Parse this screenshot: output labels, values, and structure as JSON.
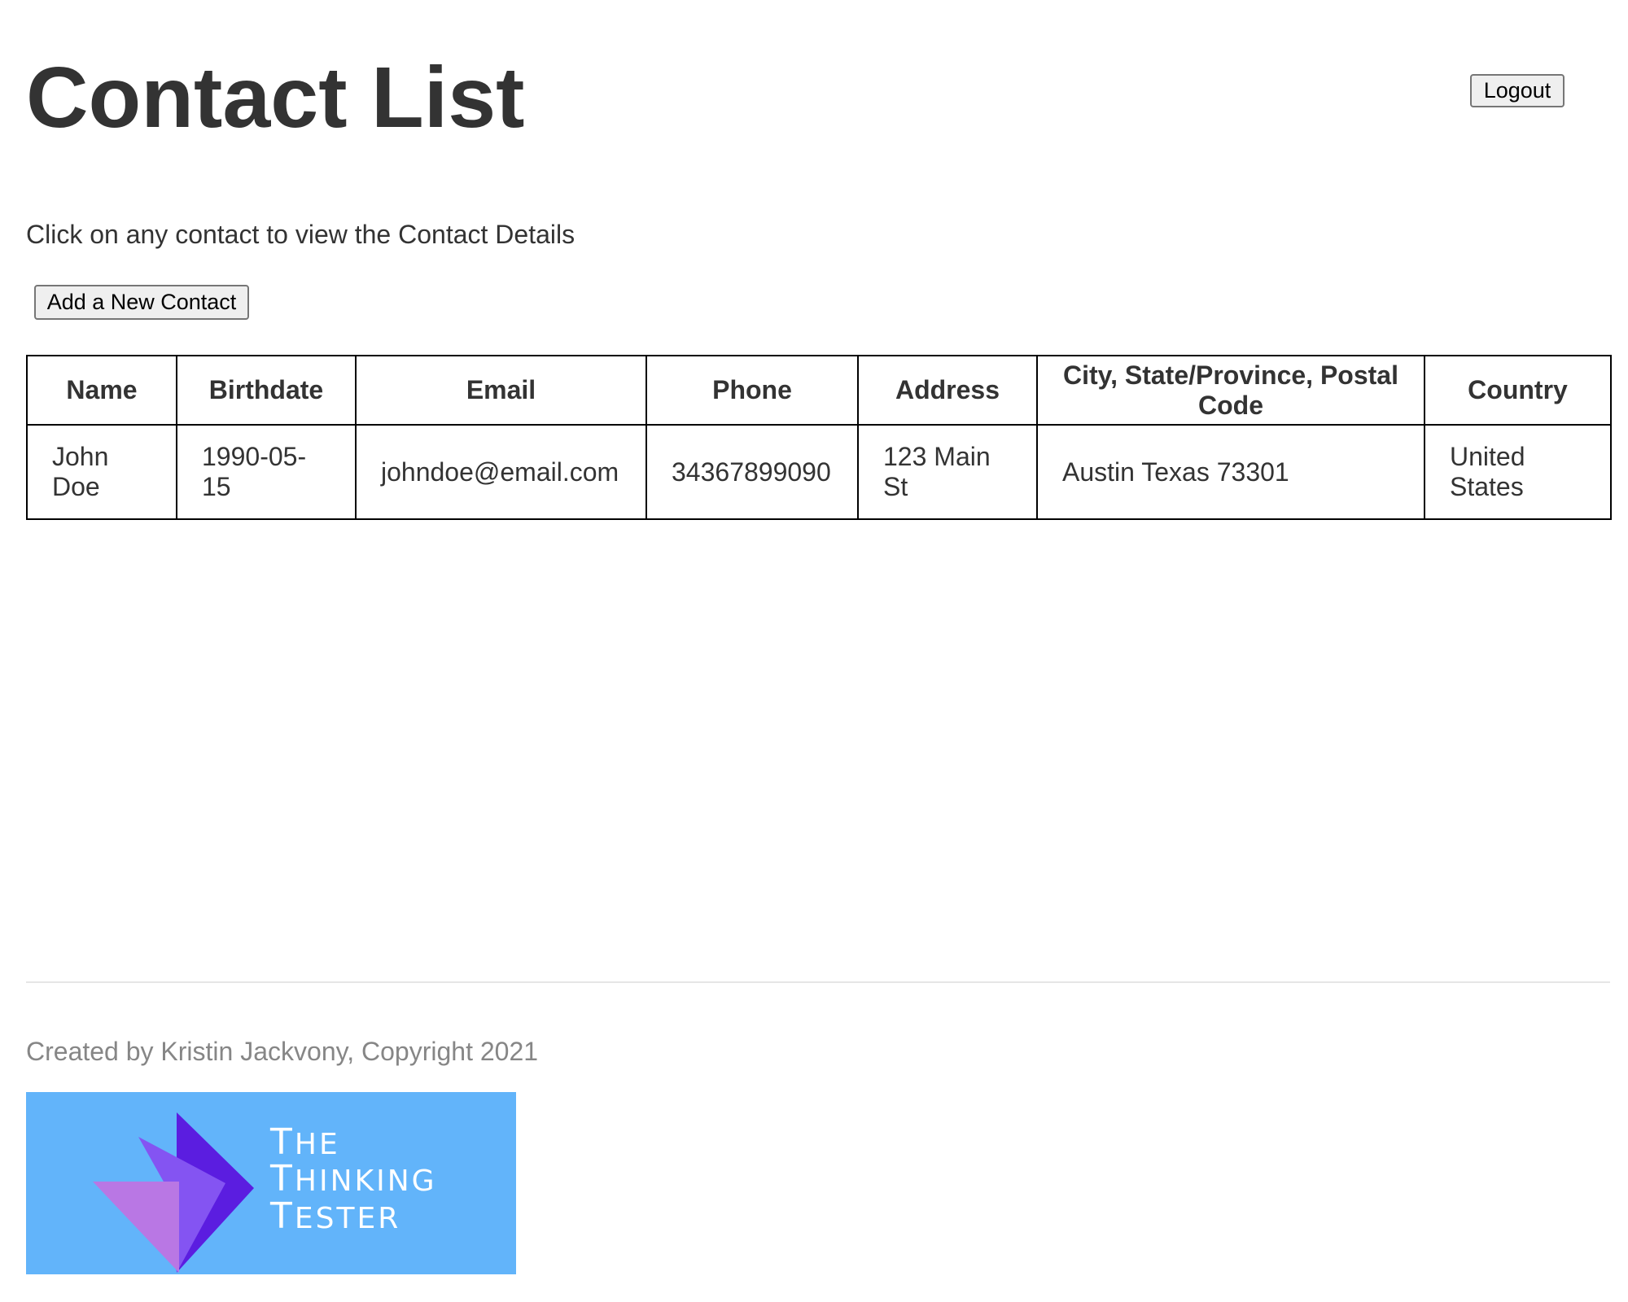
{
  "header": {
    "title": "Contact List",
    "logout_label": "Logout"
  },
  "intro": {
    "text": "Click on any contact to view the Contact Details"
  },
  "toolbar": {
    "add_contact_label": "Add a New Contact"
  },
  "table": {
    "columns": [
      "Name",
      "Birthdate",
      "Email",
      "Phone",
      "Address",
      "City, State/Province, Postal Code",
      "Country"
    ],
    "rows": [
      [
        "John Doe",
        "1990-05-15",
        "johndoe@email.com",
        "34367899090",
        "123 Main St",
        "Austin Texas 73301",
        "United States"
      ]
    ]
  },
  "footer": {
    "credit": "Created by Kristin Jackvony, Copyright 2021",
    "logo": {
      "line1": "The",
      "line2": "Thinking",
      "line3": "Tester"
    }
  },
  "colors": {
    "logo_background": "#62b4fa",
    "logo_purple_dark": "#5b1de0",
    "logo_purple_mid": "#8454f2",
    "logo_purple_light": "#b977e4",
    "heading_text": "#333333",
    "footer_text": "#868686"
  }
}
